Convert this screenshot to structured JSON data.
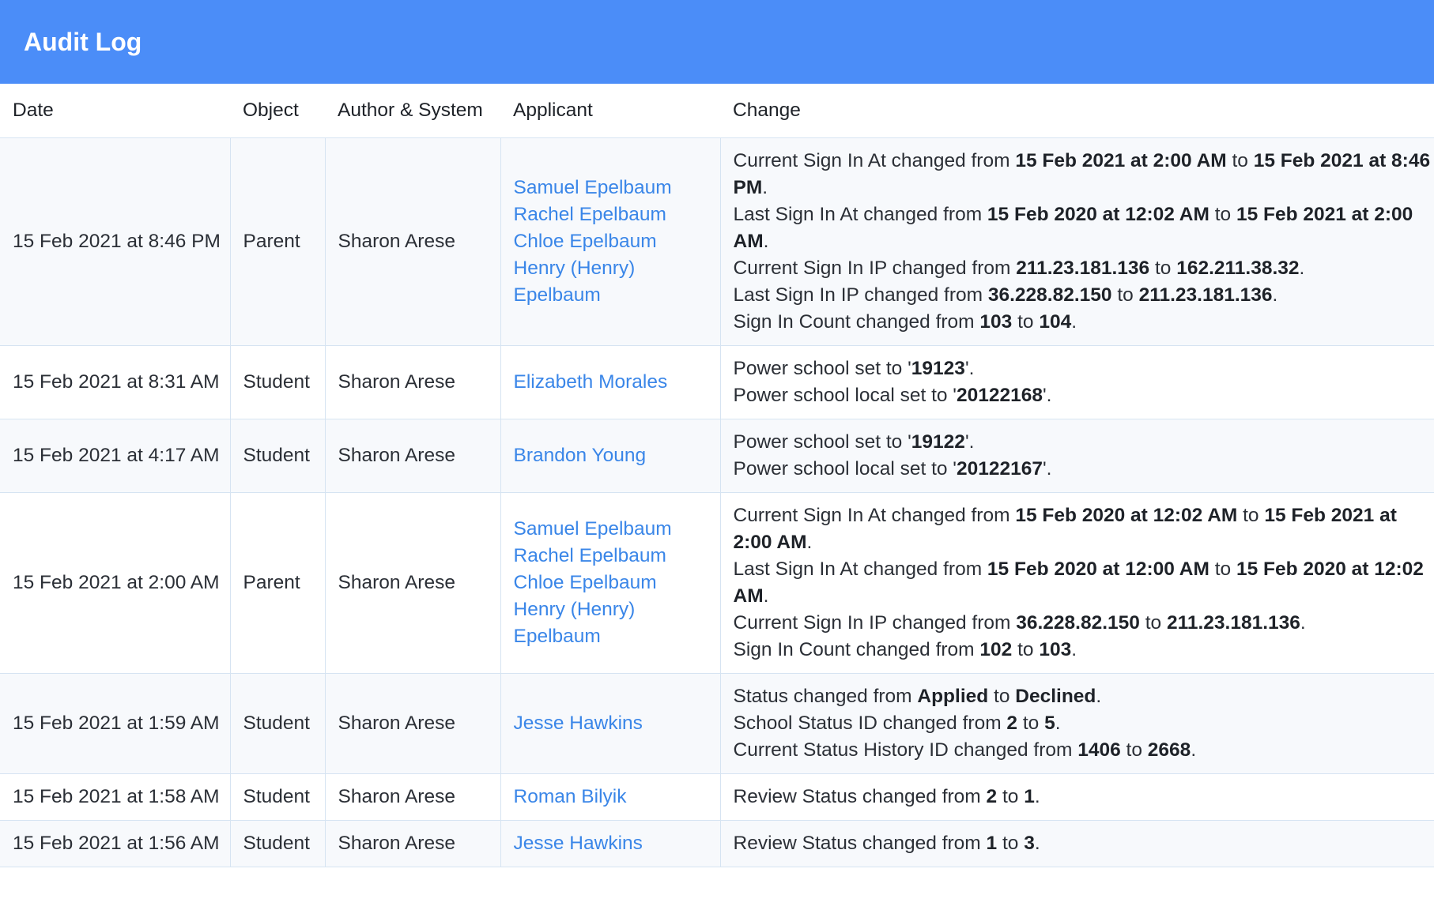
{
  "header": {
    "title": "Audit Log"
  },
  "columns": {
    "date": "Date",
    "object": "Object",
    "author": "Author & System",
    "applicant": "Applicant",
    "change": "Change"
  },
  "rows": [
    {
      "date": "15 Feb 2021 at 8:46 PM",
      "object": "Parent",
      "author": "Sharon Arese",
      "applicants": [
        "Samuel Epelbaum",
        "Rachel Epelbaum",
        "Chloe Epelbaum",
        "Henry (Henry) Epelbaum"
      ],
      "changes": [
        [
          "Current Sign In At changed from ",
          {
            "b": "15 Feb 2021 at 2:00 AM"
          },
          " to ",
          {
            "b": "15 Feb 2021 at 8:46 PM"
          },
          "."
        ],
        [
          "Last Sign In At changed from ",
          {
            "b": "15 Feb 2020 at 12:02 AM"
          },
          " to ",
          {
            "b": "15 Feb 2021 at 2:00 AM"
          },
          "."
        ],
        [
          "Current Sign In IP changed from ",
          {
            "b": "211.23.181.136"
          },
          " to ",
          {
            "b": "162.211.38.32"
          },
          "."
        ],
        [
          "Last Sign In IP changed from ",
          {
            "b": "36.228.82.150"
          },
          " to ",
          {
            "b": "211.23.181.136"
          },
          "."
        ],
        [
          "Sign In Count changed from ",
          {
            "b": "103"
          },
          " to ",
          {
            "b": "104"
          },
          "."
        ]
      ]
    },
    {
      "date": "15 Feb 2021 at 8:31 AM",
      "object": "Student",
      "author": "Sharon Arese",
      "applicants": [
        "Elizabeth Morales"
      ],
      "changes": [
        [
          "Power school set to '",
          {
            "b": "19123"
          },
          "'."
        ],
        [
          "Power school local set to '",
          {
            "b": "20122168"
          },
          "'."
        ]
      ]
    },
    {
      "date": "15 Feb 2021 at 4:17 AM",
      "object": "Student",
      "author": "Sharon Arese",
      "applicants": [
        "Brandon Young"
      ],
      "changes": [
        [
          "Power school set to '",
          {
            "b": "19122"
          },
          "'."
        ],
        [
          "Power school local set to '",
          {
            "b": "20122167"
          },
          "'."
        ]
      ]
    },
    {
      "date": "15 Feb 2021 at 2:00 AM",
      "object": "Parent",
      "author": "Sharon Arese",
      "applicants": [
        "Samuel Epelbaum",
        "Rachel Epelbaum",
        "Chloe Epelbaum",
        "Henry (Henry) Epelbaum"
      ],
      "changes": [
        [
          "Current Sign In At changed from ",
          {
            "b": "15 Feb 2020 at 12:02 AM"
          },
          " to ",
          {
            "b": "15 Feb 2021 at 2:00 AM"
          },
          "."
        ],
        [
          "Last Sign In At changed from ",
          {
            "b": "15 Feb 2020 at 12:00 AM"
          },
          " to ",
          {
            "b": "15 Feb 2020 at 12:02 AM"
          },
          "."
        ],
        [
          "Current Sign In IP changed from ",
          {
            "b": "36.228.82.150"
          },
          " to ",
          {
            "b": "211.23.181.136"
          },
          "."
        ],
        [
          "Sign In Count changed from ",
          {
            "b": "102"
          },
          " to ",
          {
            "b": "103"
          },
          "."
        ]
      ]
    },
    {
      "date": "15 Feb 2021 at 1:59 AM",
      "object": "Student",
      "author": "Sharon Arese",
      "applicants": [
        "Jesse Hawkins"
      ],
      "changes": [
        [
          "Status changed from ",
          {
            "b": "Applied"
          },
          " to ",
          {
            "b": "Declined"
          },
          "."
        ],
        [
          "School Status ID changed from ",
          {
            "b": "2"
          },
          " to ",
          {
            "b": "5"
          },
          "."
        ],
        [
          "Current Status History ID changed from ",
          {
            "b": "1406"
          },
          " to ",
          {
            "b": "2668"
          },
          "."
        ]
      ]
    },
    {
      "date": "15 Feb 2021 at 1:58 AM",
      "object": "Student",
      "author": "Sharon Arese",
      "applicants": [
        "Roman Bilyik"
      ],
      "changes": [
        [
          "Review Status changed from ",
          {
            "b": "2"
          },
          " to ",
          {
            "b": "1"
          },
          "."
        ]
      ]
    },
    {
      "date": "15 Feb 2021 at 1:56 AM",
      "object": "Student",
      "author": "Sharon Arese",
      "applicants": [
        "Jesse Hawkins"
      ],
      "changes": [
        [
          "Review Status changed from ",
          {
            "b": "1"
          },
          " to ",
          {
            "b": "3"
          },
          "."
        ]
      ]
    }
  ]
}
